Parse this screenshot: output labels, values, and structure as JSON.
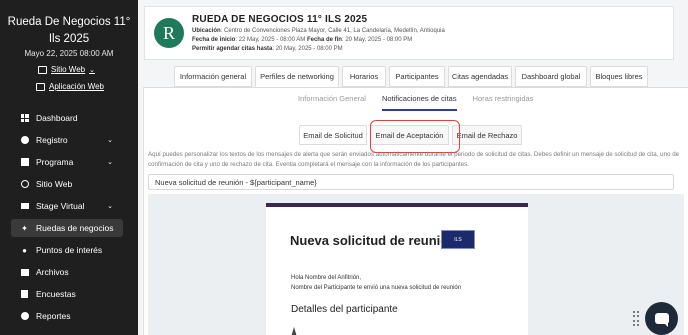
{
  "sidebar": {
    "title_line1": "Rueda De Negocios 11°",
    "title_line2": "Ils 2025",
    "date": "Mayo 22, 2025 08:00 AM",
    "link_site": "Sitio Web",
    "link_app": "Aplicación Web",
    "items": [
      {
        "label": "Dashboard",
        "icon": "grid-icon"
      },
      {
        "label": "Registro",
        "icon": "user-icon",
        "chevron": "⌄"
      },
      {
        "label": "Programa",
        "icon": "calendar-icon",
        "chevron": "⌄"
      },
      {
        "label": "Sitio Web",
        "icon": "globe-icon"
      },
      {
        "label": "Stage Virtual",
        "icon": "video-icon",
        "chevron": "⌄"
      },
      {
        "label": "Ruedas de negocios",
        "icon": "handshake-icon"
      },
      {
        "label": "Puntos de interés",
        "icon": "pin-icon"
      },
      {
        "label": "Archivos",
        "icon": "folder-icon"
      },
      {
        "label": "Encuestas",
        "icon": "survey-icon"
      },
      {
        "label": "Reportes",
        "icon": "report-icon"
      }
    ]
  },
  "event": {
    "avatar_letter": "R",
    "title": "RUEDA DE NEGOCIOS 11° ILS 2025",
    "location_label": "Ubicación",
    "location": ": Centro de Convenciones Plaza Mayor, Calle 41, La Candelaria, Medellín, Antioquia",
    "start_label": "Fecha de inicio",
    "start": ": 22 May, 2025 - 08:00 AM",
    "end_label": "Fecha de fin",
    "end": ": 20 May, 2025 - 08:00 PM",
    "limit_label": "Permitir agendar citas hasta",
    "limit": ": 20 May, 2025 - 08:00 PM"
  },
  "tabs": [
    "Información general",
    "Perfiles de networking",
    "Horarios",
    "Participantes",
    "Citas agendadas",
    "Dashboard global",
    "Bloques libres"
  ],
  "subtabs": [
    "Información General",
    "Notificaciones de citas",
    "Horas restringidas"
  ],
  "email_tabs": [
    "Email de Solicitud",
    "Email de Aceptación",
    "Email de Rechazo"
  ],
  "description": "Aquí puedes personalizar los textos de los mensajes de alerta que serán enviados automáticamente durante el periodo de solicitud de citas. Debes definir un mensaje de solicitud de cita, uno de confirmación de cita y uno de rechazo de cita. Eventia completará el mensaje con la información de los participantes.",
  "subject_value": "Nueva solicitud de reunión - ${participant_name}",
  "email": {
    "heading": "Nueva solicitud de reunión",
    "logo_text": "ILS",
    "greeting": "Hola Nombre del Anfitrión,",
    "body": "Nombre del Participante te envió una nueva solicitud de reunión",
    "section": "Detalles del participante"
  },
  "colors": {
    "sidebar": "#1f1f1f",
    "accent": "#2f3b8f",
    "highlight": "#e0453a",
    "email_bar": "#3b2754"
  }
}
